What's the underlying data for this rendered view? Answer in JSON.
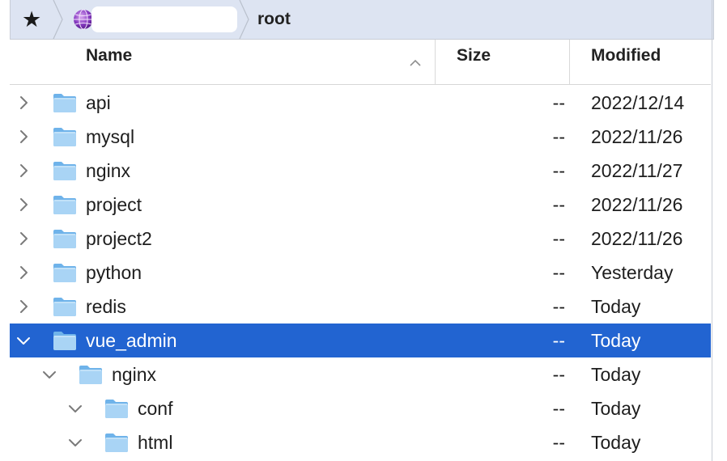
{
  "pathbar": {
    "favorites_icon": "star-icon",
    "server_icon": "globe-icon",
    "crumb": "root"
  },
  "columns": {
    "name": "Name",
    "size": "Size",
    "modified": "Modified",
    "sort_indicator": "chevron-up-icon"
  },
  "rows": [
    {
      "name": "api",
      "size": "--",
      "modified": "2022/12/14",
      "expanded": false,
      "level": 0,
      "selected": false
    },
    {
      "name": "mysql",
      "size": "--",
      "modified": "2022/11/26",
      "expanded": false,
      "level": 0,
      "selected": false
    },
    {
      "name": "nginx",
      "size": "--",
      "modified": "2022/11/27",
      "expanded": false,
      "level": 0,
      "selected": false
    },
    {
      "name": "project",
      "size": "--",
      "modified": "2022/11/26",
      "expanded": false,
      "level": 0,
      "selected": false
    },
    {
      "name": "project2",
      "size": "--",
      "modified": "2022/11/26",
      "expanded": false,
      "level": 0,
      "selected": false
    },
    {
      "name": "python",
      "size": "--",
      "modified": "Yesterday",
      "expanded": false,
      "level": 0,
      "selected": false
    },
    {
      "name": "redis",
      "size": "--",
      "modified": "Today",
      "expanded": false,
      "level": 0,
      "selected": false
    },
    {
      "name": "vue_admin",
      "size": "--",
      "modified": "Today",
      "expanded": true,
      "level": 0,
      "selected": true
    },
    {
      "name": "nginx",
      "size": "--",
      "modified": "Today",
      "expanded": true,
      "level": 1,
      "selected": false
    },
    {
      "name": "conf",
      "size": "--",
      "modified": "Today",
      "expanded": true,
      "level": 2,
      "selected": false
    },
    {
      "name": "html",
      "size": "--",
      "modified": "Today",
      "expanded": true,
      "level": 2,
      "selected": false
    }
  ],
  "colors": {
    "selection": "#2264d1",
    "pathbar_bg": "#dde4f2",
    "folder_light": "#a9d4f5",
    "folder_dark": "#6fb3ea"
  }
}
